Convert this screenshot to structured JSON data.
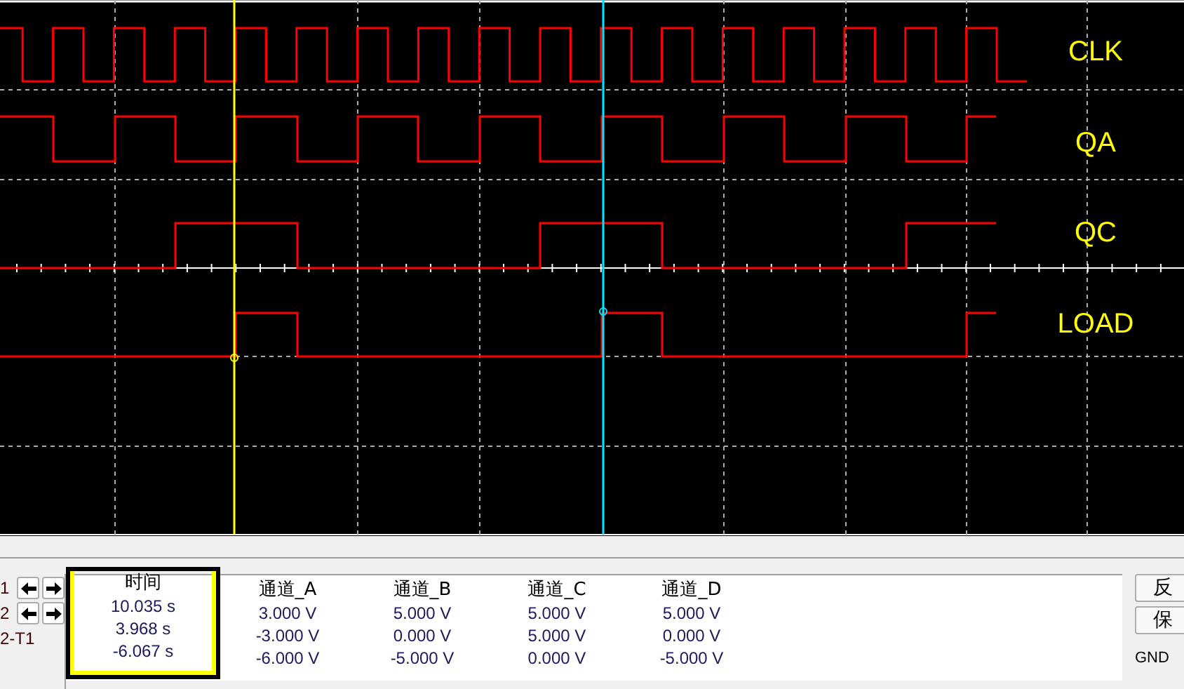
{
  "traces": [
    {
      "label": "CLK"
    },
    {
      "label": "QA"
    },
    {
      "label": "QC"
    },
    {
      "label": "LOAD"
    }
  ],
  "readout": {
    "columns": [
      {
        "label": "时间",
        "highlighted": true
      },
      {
        "label": "通道_A",
        "highlighted": false
      },
      {
        "label": "通道_B",
        "highlighted": false
      },
      {
        "label": "通道_C",
        "highlighted": false
      },
      {
        "label": "通道_D",
        "highlighted": false
      }
    ],
    "rows": [
      {
        "kind": "cursor",
        "label": "1",
        "cells": [
          "10.035 s",
          "3.000 V",
          "5.000 V",
          "5.000 V",
          "5.000 V"
        ]
      },
      {
        "kind": "cursor",
        "label": "2",
        "cells": [
          "3.968 s",
          "-3.000 V",
          "0.000 V",
          "5.000 V",
          "0.000 V"
        ]
      },
      {
        "kind": "delta",
        "label": "2-T1",
        "cells": [
          "-6.067 s",
          "-6.000 V",
          "-5.000 V",
          "0.000 V",
          "-5.000 V"
        ]
      }
    ]
  },
  "buttons": [
    "反",
    "保"
  ],
  "ground_label": "GND"
}
